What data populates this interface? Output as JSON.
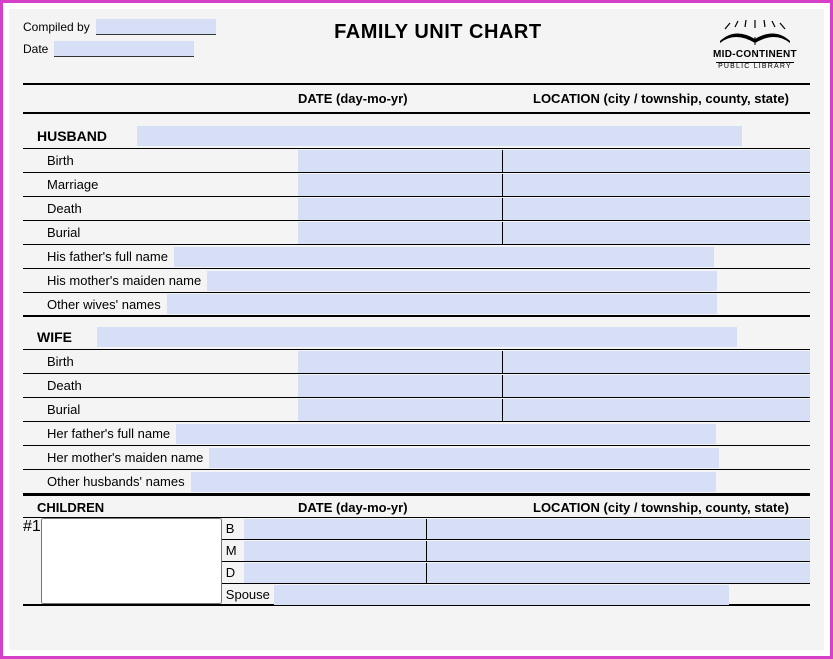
{
  "header": {
    "compiled_by_label": "Compiled by",
    "compiled_by_value": "",
    "date_label": "Date",
    "date_value": "",
    "title": "FAMILY UNIT CHART",
    "org_name": "MID-CONTINENT",
    "org_sub": "PUBLIC LIBRARY"
  },
  "columns": {
    "date": "DATE (day-mo-yr)",
    "location": "LOCATION (city / township, county, state)"
  },
  "husband": {
    "label": "HUSBAND",
    "name": "",
    "rows": [
      {
        "label": "Birth",
        "date": "",
        "location": ""
      },
      {
        "label": "Marriage",
        "date": "",
        "location": ""
      },
      {
        "label": "Death",
        "date": "",
        "location": ""
      },
      {
        "label": "Burial",
        "date": "",
        "location": ""
      }
    ],
    "father_label": "His father's full name",
    "father_value": "",
    "mother_label": "His mother's maiden name",
    "mother_value": "",
    "other_label": "Other wives' names",
    "other_value": ""
  },
  "wife": {
    "label": "WIFE",
    "name": "",
    "rows": [
      {
        "label": "Birth",
        "date": "",
        "location": ""
      },
      {
        "label": "Death",
        "date": "",
        "location": ""
      },
      {
        "label": "Burial",
        "date": "",
        "location": ""
      }
    ],
    "father_label": "Her father's full name",
    "father_value": "",
    "mother_label": "Her mother's maiden name",
    "mother_value": "",
    "other_label": "Other husbands' names",
    "other_value": ""
  },
  "children": {
    "label": "CHILDREN",
    "date_col": "DATE (day-mo-yr)",
    "loc_col": "LOCATION (city / township, county, state)",
    "child1": {
      "num": "#1",
      "name": "",
      "b_code": "B",
      "b_date": "",
      "b_loc": "",
      "m_code": "M",
      "m_date": "",
      "m_loc": "",
      "d_code": "D",
      "d_date": "",
      "d_loc": "",
      "sp_code": "Spouse",
      "sp_value": ""
    }
  }
}
